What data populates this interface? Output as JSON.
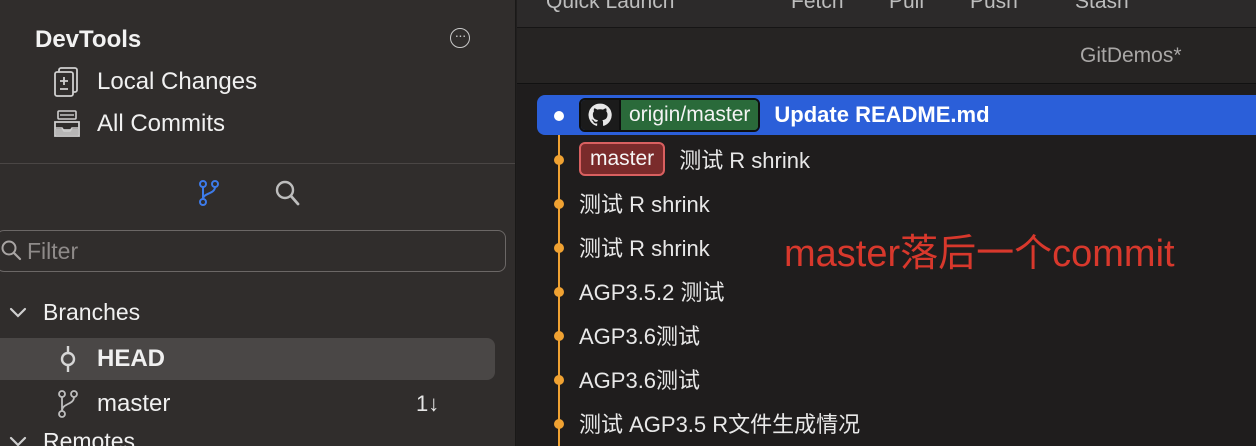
{
  "toolbar": {
    "quick_launch": "Quick Launch",
    "fetch": "Fetch",
    "pull": "Pull",
    "push": "Push",
    "stash": "Stash"
  },
  "sidebar": {
    "repo_title": "DevTools",
    "local_changes": "Local Changes",
    "all_commits": "All Commits",
    "filter_placeholder": "Filter",
    "branches_group": "Branches",
    "branches": [
      {
        "name": "HEAD",
        "selected": true,
        "count": ""
      },
      {
        "name": "master",
        "selected": false,
        "count": "1↓"
      }
    ],
    "remotes_group": "Remotes"
  },
  "repo_bar": {
    "name": "GitDemos*"
  },
  "commits": [
    {
      "remote_badge": "origin/master",
      "message": "Update README.md",
      "selected": true
    },
    {
      "local_badge": "master",
      "message": "测试 R shrink"
    },
    {
      "message": "测试 R shrink"
    },
    {
      "message": "测试 R shrink"
    },
    {
      "message": "AGP3.5.2 测试"
    },
    {
      "message": "AGP3.6测试"
    },
    {
      "message": "AGP3.6测试"
    },
    {
      "message": "测试 AGP3.5 R文件生成情况"
    }
  ],
  "annotation": "master落后一个commit",
  "colors": {
    "graph": "#f0a232",
    "selection": "#2b5fd9",
    "remote_badge": "#2a6a3a",
    "local_badge": "#7a2b2b",
    "annotation": "#d8382c",
    "active_toggle": "#3d7bea"
  }
}
